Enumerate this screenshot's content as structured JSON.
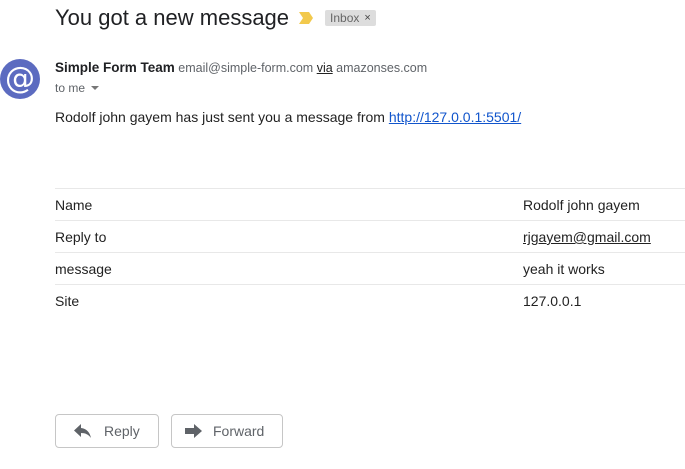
{
  "email": {
    "subject": "You got a new message",
    "label": "Inbox",
    "label_remove": "×",
    "avatar_glyph": "@",
    "sender": {
      "name": "Simple Form Team",
      "email": "email@simple-form.com",
      "via_label": "via",
      "via_domain": "amazonses.com"
    },
    "recipient": "to me",
    "intro_text": "Rodolf john gayem has just sent you a message from ",
    "intro_link": "http://127.0.0.1:5501/",
    "fields": [
      {
        "label": "Name",
        "value": "Rodolf john gayem",
        "is_link": false
      },
      {
        "label": "Reply to",
        "value": "rjgayem@gmail.com",
        "is_link": true
      },
      {
        "label": "message",
        "value": "yeah it works",
        "is_link": false
      },
      {
        "label": "Site",
        "value": "127.0.0.1",
        "is_link": false
      }
    ]
  },
  "actions": {
    "reply_label": "Reply",
    "forward_label": "Forward"
  },
  "colors": {
    "avatar_bg": "#5c6bc0",
    "importance_marker": "#f2c94c",
    "link": "#1155cc",
    "label_chip_bg": "#dddddd"
  },
  "icons": {
    "importance": "importance-marker-icon",
    "caret": "chevron-down-icon",
    "reply": "reply-arrow-icon",
    "forward": "forward-arrow-icon"
  }
}
